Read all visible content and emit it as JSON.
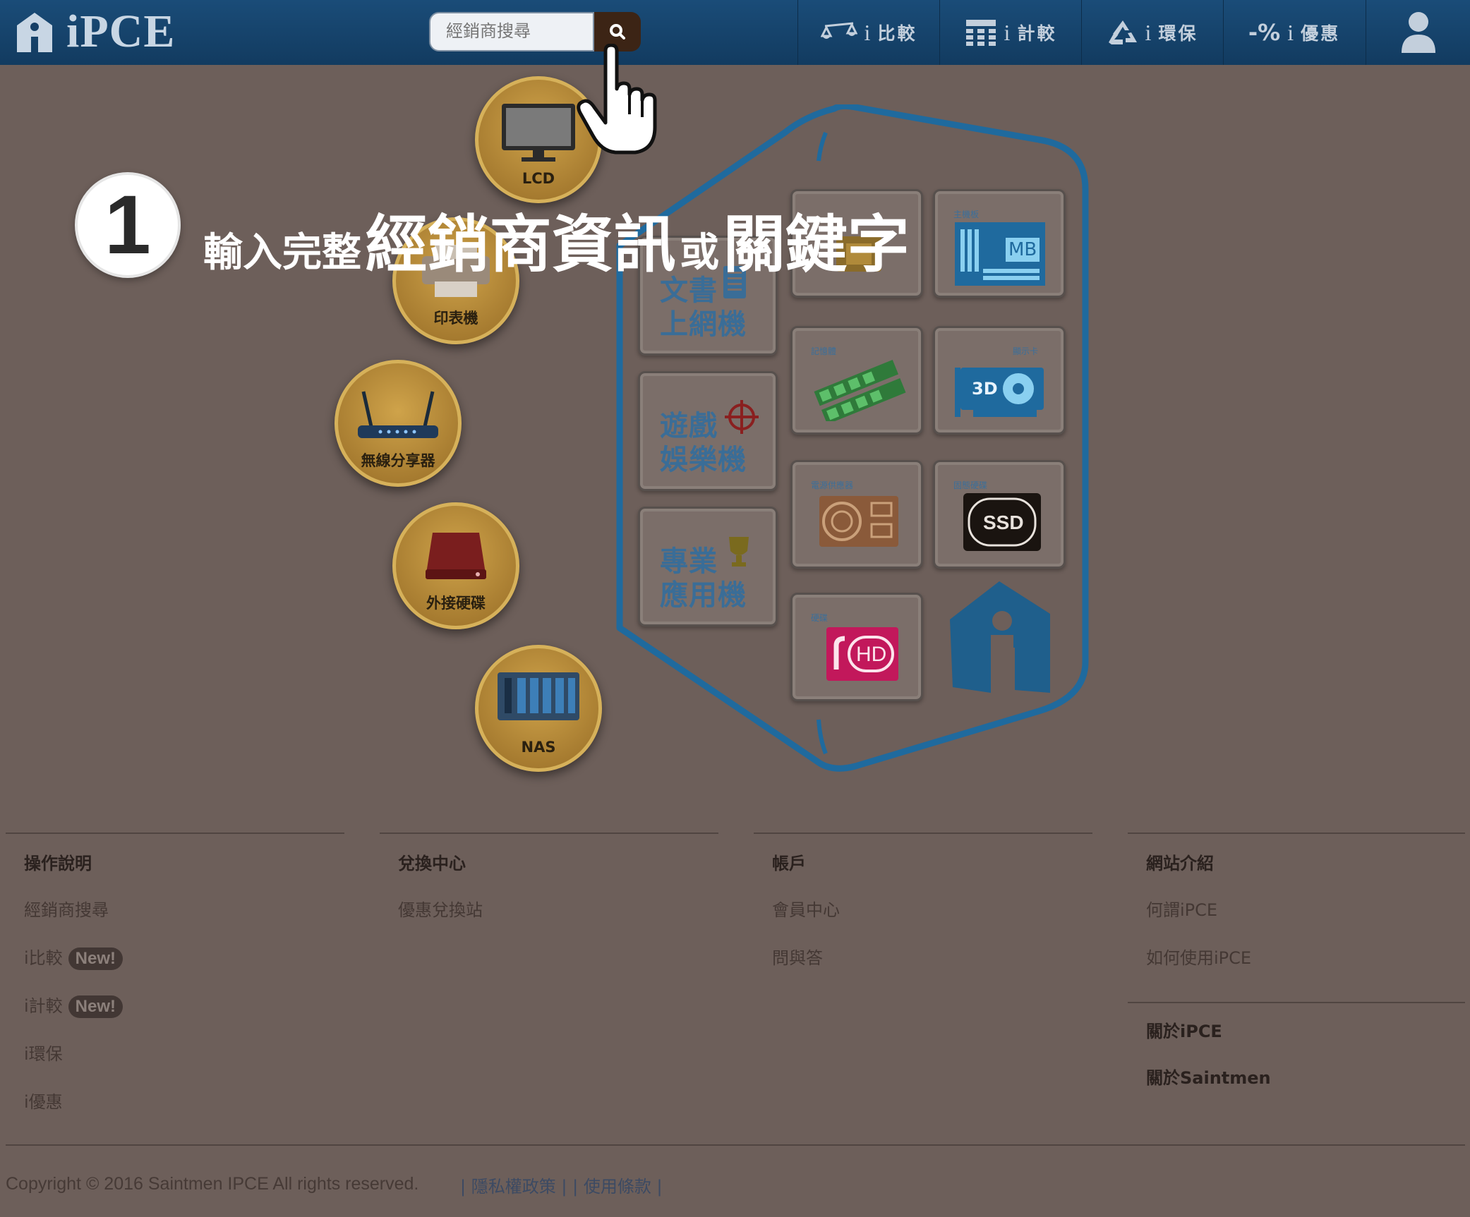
{
  "nav": {
    "logo_text": "iPCE",
    "search": {
      "placeholder": "經銷商搜尋"
    },
    "items": [
      {
        "i": "i",
        "label": "比較"
      },
      {
        "i": "i",
        "label": "計較"
      },
      {
        "i": "i",
        "label": "環保"
      },
      {
        "i": "i",
        "label": "優惠"
      }
    ],
    "discount_glyph": "-%"
  },
  "overlay": {
    "step_number": "1",
    "text_prefix": "輸入完整",
    "text_main1": "經銷商資訊",
    "text_or": "或",
    "text_main2": "關鍵字"
  },
  "categories": {
    "lcd": "LCD",
    "printer": "印表機",
    "router": "無線分享器",
    "external_hdd": "外接硬碟",
    "nas": "NAS"
  },
  "tiles": {
    "office_line1": "文書",
    "office_line2": "上網機",
    "gaming_line1": "遊戲",
    "gaming_line2": "娛樂機",
    "pro_line1": "專業",
    "pro_line2": "應用機",
    "mb_caption": "主機板",
    "mb_label": "MB",
    "ram_caption": "記憶體",
    "gpu_caption": "顯示卡",
    "gpu_label": "3D",
    "psu_caption": "電源供應器",
    "ssd_caption": "固態硬碟",
    "ssd_label": "SSD",
    "hdd_caption": "硬碟",
    "hdd_label": "HD"
  },
  "footer": {
    "col1": {
      "title": "操作說明",
      "links": [
        "經銷商搜尋",
        "i比較",
        "i計較",
        "i環保",
        "i優惠"
      ],
      "new_badge": "New!"
    },
    "col2": {
      "title": "兌換中心",
      "links": [
        "優惠兌換站"
      ]
    },
    "col3": {
      "title": "帳戶",
      "links": [
        "會員中心",
        "問與答"
      ]
    },
    "col4": {
      "title": "網站介紹",
      "links": [
        "何謂iPCE",
        "如何使用iPCE"
      ],
      "links2": [
        "關於iPCE",
        "關於Saintmen"
      ]
    },
    "copyright": "Copyright © 2016 Saintmen IPCE All rights reserved.",
    "privacy": "隱私權政策",
    "terms": "使用條款",
    "separator": "|"
  },
  "colors": {
    "nav_bg": "#163f66",
    "overlay_bg": "#6d5f5a",
    "shield_stroke": "#1f6a9e",
    "tile_text": "#3a6d97",
    "circle_gold": "#b8892f"
  }
}
